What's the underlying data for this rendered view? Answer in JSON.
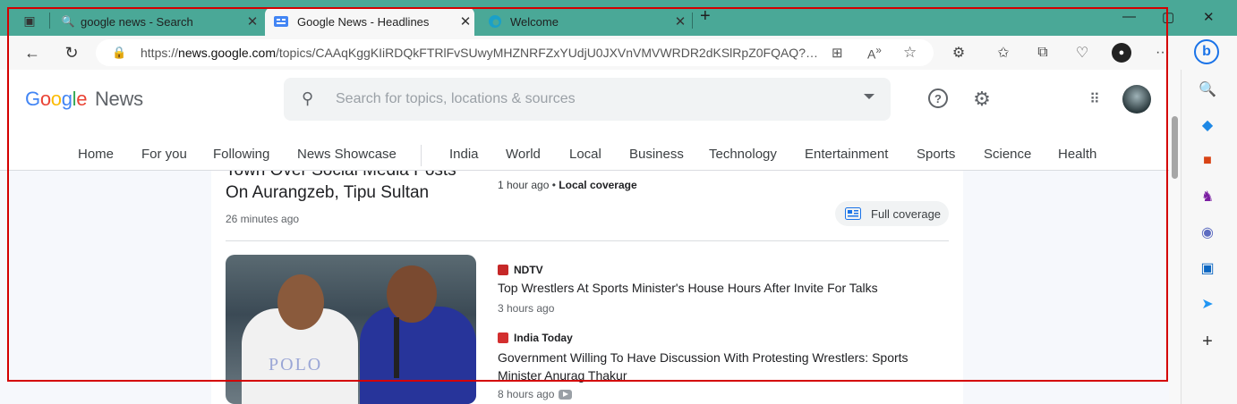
{
  "browser": {
    "tabs": [
      {
        "title": "google news - Search"
      },
      {
        "title": "Google News - Headlines"
      },
      {
        "title": "Welcome"
      }
    ],
    "address": {
      "prefix": "https://",
      "domain": "news.google.com",
      "path": "/topics/CAAqKggKIiRDQkFTRlFvSUwyMHZNRFZxYUdjU0JXVnVMVWRDR2dKSlRpZ0FQAQ?hl=en..."
    }
  },
  "google": {
    "logo_google": "Google",
    "logo_news": "News",
    "search_placeholder": "Search for topics, locations & sources",
    "nav": [
      "Home",
      "For you",
      "Following",
      "News Showcase",
      "India",
      "World",
      "Local",
      "Business",
      "Technology",
      "Entertainment",
      "Sports",
      "Science",
      "Health"
    ]
  },
  "story1": {
    "headline_partial": "Town Over Social Media Posts",
    "headline": "On Aurangzeb, Tipu Sultan",
    "time": "26 minutes ago",
    "side_time": "1 hour ago",
    "side_dot": "•",
    "side_label": "Local coverage",
    "full_coverage": "Full coverage"
  },
  "story2": {
    "photo_caption": "POLO",
    "items": [
      {
        "source": "NDTV",
        "headline": "Top Wrestlers At Sports Minister's House Hours After Invite For Talks",
        "time": "3 hours ago"
      },
      {
        "source": "India Today",
        "headline": "Government Willing To Have Discussion With Protesting Wrestlers: Sports Minister Anurag Thakur",
        "time": "8 hours ago"
      }
    ]
  },
  "colors": {
    "tabbar": "#4aa897",
    "ndtv": "#c62828",
    "indiatoday": "#d32f2f",
    "highlight_box": "#d40000"
  }
}
